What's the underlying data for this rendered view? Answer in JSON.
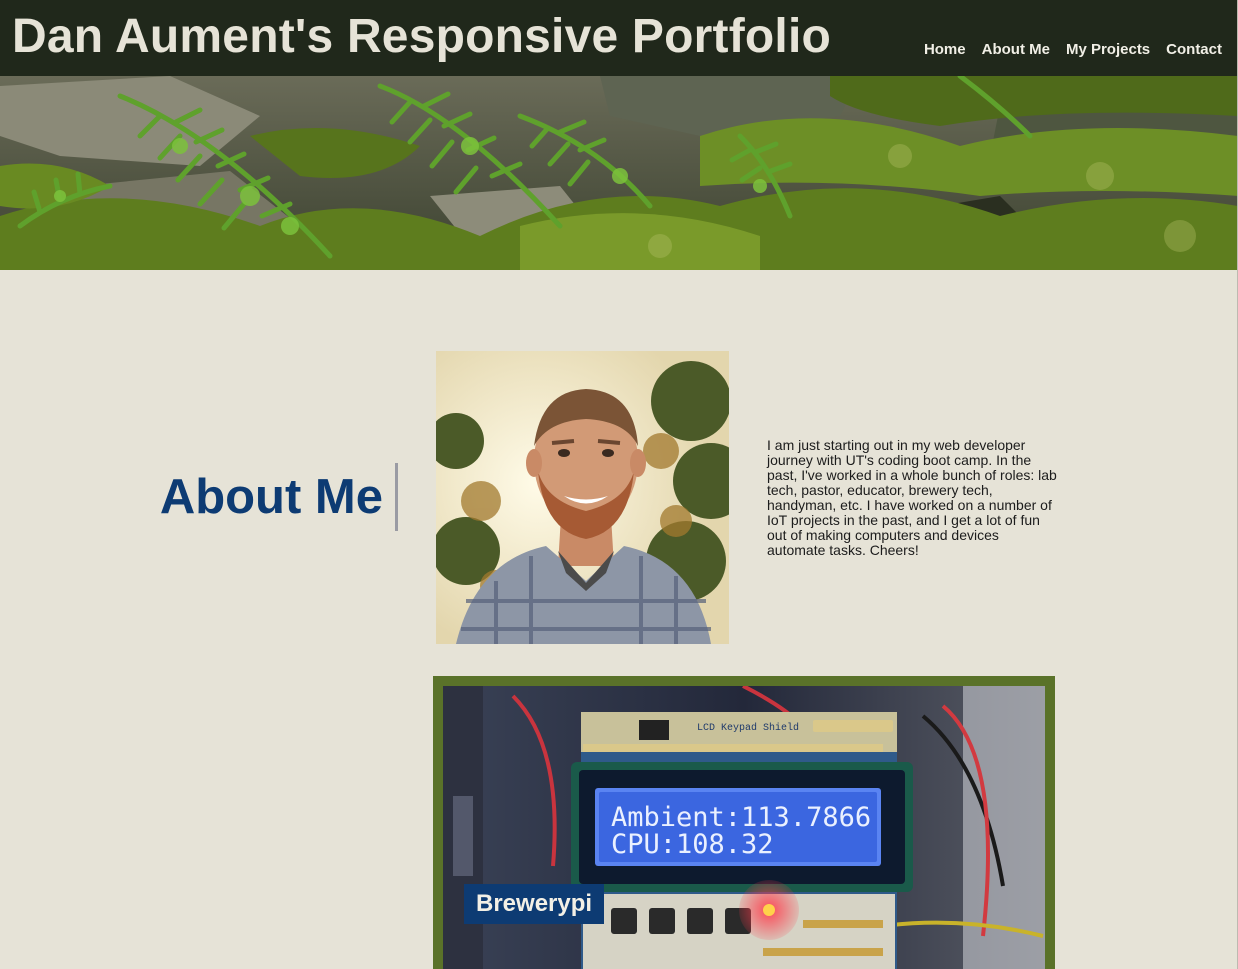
{
  "header": {
    "title": "Dan Aument's Responsive Portfolio",
    "nav": [
      {
        "label": "Home"
      },
      {
        "label": "About Me"
      },
      {
        "label": "My Projects"
      },
      {
        "label": "Contact"
      }
    ]
  },
  "hero": {
    "icon": "fern-moss-banner-image"
  },
  "about": {
    "heading": "About Me",
    "bio": "I am just starting out in my web developer journey with UT's coding boot camp. In the past, I've worked in a whole bunch of roles: lab tech, pastor, educator, brewery tech, handyman, etc. I have worked on a number of IoT projects in the past, and I get a lot of fun out of making computers and devices automate tasks. Cheers!"
  },
  "projects": [
    {
      "label": "Brewerypi",
      "lcd_line1": "Ambient:113.7866",
      "lcd_line2": "CPU:108.32",
      "shield_text": "LCD Keypad Shield"
    }
  ],
  "colors": {
    "header_bg": "#20281b",
    "page_bg": "#e6e3d7",
    "accent_blue": "#0d3b73",
    "card_green": "#5a7229"
  }
}
